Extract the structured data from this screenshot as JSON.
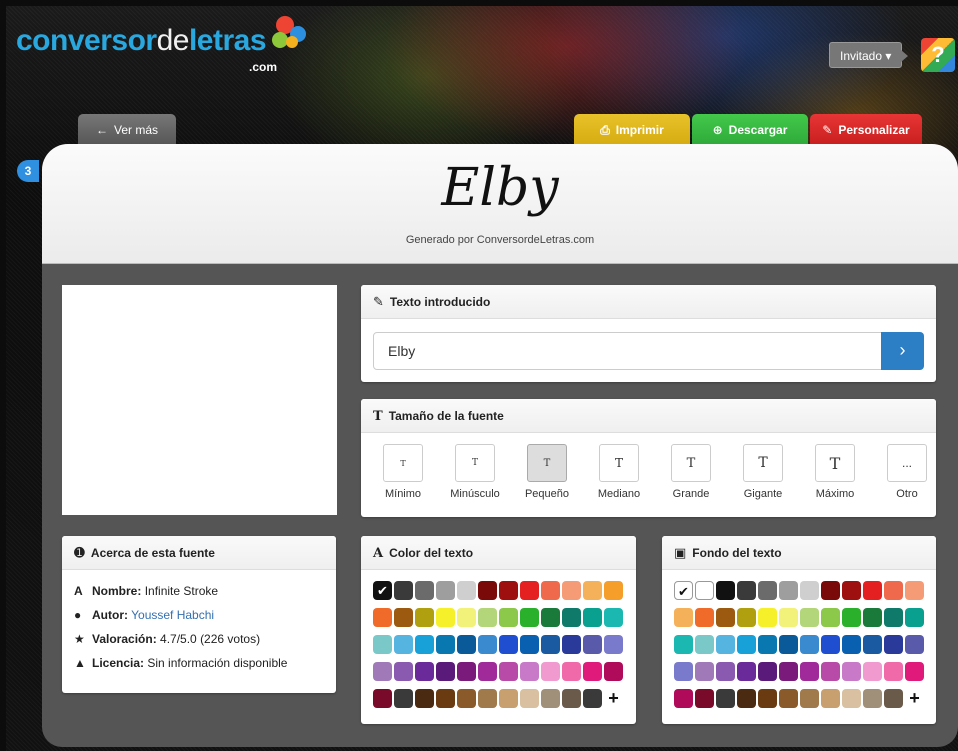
{
  "logo": {
    "part1": "conversor",
    "part2": "de",
    "part3": "letras",
    "com": ".com"
  },
  "header": {
    "user_label": "Invitado ▾",
    "help_label": "?",
    "counter": "3"
  },
  "tabs": {
    "back": "Ver más",
    "print": "Imprimir",
    "download": "Descargar",
    "customize": "Personalizar"
  },
  "font": {
    "name": "Elby",
    "generated_by": "Generado por ConversordeLetras.com"
  },
  "text_card": {
    "title": "Texto introducido",
    "value": "Elby"
  },
  "size_card": {
    "title": "Tamaño de la fuente",
    "options": [
      {
        "label": "Mínimo"
      },
      {
        "label": "Minúsculo"
      },
      {
        "label": "Pequeño",
        "selected": true
      },
      {
        "label": "Mediano"
      },
      {
        "label": "Grande"
      },
      {
        "label": "Gigante"
      },
      {
        "label": "Máximo"
      },
      {
        "label": "Otro"
      }
    ],
    "other_symbol": "..."
  },
  "about_card": {
    "title": "Acerca de esta fuente",
    "name_key": "Nombre:",
    "name_val": "Infinite Stroke",
    "author_key": "Autor:",
    "author_val": "Youssef Habchi",
    "rating_key": "Valoración:",
    "rating_val": "4.7/5.0 (226 votos)",
    "license_key": "Licencia:",
    "license_val": "Sin información disponible"
  },
  "color_card": {
    "title": "Color del texto",
    "colors": [
      "#111111",
      "#3a3a3a",
      "#6b6b6b",
      "#9e9e9e",
      "#cfcfcf",
      "#7a0a0a",
      "#9e1010",
      "#e42020",
      "#ef6a4c",
      "#f59b76",
      "#f5b05a",
      "#f59e2a",
      "#f06a2a",
      "#9c5a10",
      "#b0a010",
      "#f5f02a",
      "#f2f27a",
      "#b4d67a",
      "#8cc84a",
      "#2ab02a",
      "#1a7a3a",
      "#0f7a6a",
      "#0aa090",
      "#1ab8b0",
      "#7ac8c8",
      "#56b4e0",
      "#18a0d8",
      "#0a78b0",
      "#0a5a9a",
      "#3a8ad0",
      "#1f4fd0",
      "#0a60b0",
      "#1a5aa0",
      "#2a3a9a",
      "#5a5aaa",
      "#7a7acc",
      "#a07ab8",
      "#8a5ab0",
      "#6a2a9a",
      "#5a1a7a",
      "#7a1a7a",
      "#a02a9a",
      "#b84aa8",
      "#c87ac8",
      "#f09ad0",
      "#f06aaa",
      "#e01a7a",
      "#b00a5a",
      "#7a0a2a",
      "#3a3a3a",
      "#4a2a10",
      "#6a3a10",
      "#8a5a2a",
      "#a07a4a",
      "#c8a070",
      "#d8c0a0",
      "#a0907a",
      "#6a5a4a",
      "#3a3a3a"
    ]
  },
  "bg_card": {
    "title": "Fondo del texto",
    "colors": [
      "#ffffff",
      "#111111",
      "#3a3a3a",
      "#6b6b6b",
      "#9e9e9e",
      "#cfcfcf",
      "#7a0a0a",
      "#9e1010",
      "#e42020",
      "#ef6a4c",
      "#f59b76",
      "#f5b05a",
      "#f06a2a",
      "#9c5a10",
      "#b0a010",
      "#f5f02a",
      "#f2f27a",
      "#b4d67a",
      "#8cc84a",
      "#2ab02a",
      "#1a7a3a",
      "#0f7a6a",
      "#0aa090",
      "#1ab8b0",
      "#7ac8c8",
      "#56b4e0",
      "#18a0d8",
      "#0a78b0",
      "#0a5a9a",
      "#3a8ad0",
      "#1f4fd0",
      "#0a60b0",
      "#1a5aa0",
      "#2a3a9a",
      "#5a5aaa",
      "#7a7acc",
      "#a07ab8",
      "#8a5ab0",
      "#6a2a9a",
      "#5a1a7a",
      "#7a1a7a",
      "#a02a9a",
      "#b84aa8",
      "#c87ac8",
      "#f09ad0",
      "#f06aaa",
      "#e01a7a",
      "#b00a5a",
      "#7a0a2a",
      "#3a3a3a",
      "#4a2a10",
      "#6a3a10",
      "#8a5a2a",
      "#a07a4a",
      "#c8a070",
      "#d8c0a0",
      "#a0907a",
      "#6a5a4a"
    ]
  },
  "plus_label": "+"
}
